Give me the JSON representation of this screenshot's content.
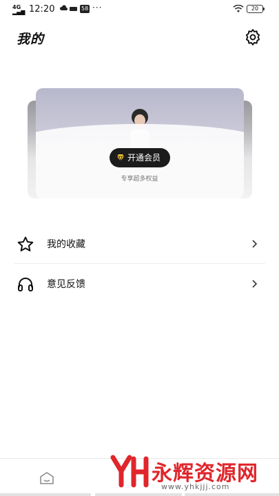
{
  "status_bar": {
    "signal_text": "4G",
    "time": "12:20",
    "badge": "58",
    "more_dots": "···",
    "battery": "20"
  },
  "header": {
    "title": "我的"
  },
  "member_card": {
    "button_label": "开通会员",
    "subtitle": "专享超多权益"
  },
  "menu": {
    "items": [
      {
        "label": "我的收藏",
        "icon": "star-icon"
      },
      {
        "label": "意见反馈",
        "icon": "headphones-icon"
      }
    ]
  },
  "watermark": {
    "title": "永辉资源网",
    "url": "www.yhkjjj.com"
  },
  "colors": {
    "accent_gold": "#f5c43a",
    "watermark_red": "#e0262b",
    "dark_button": "#1c1c1c"
  }
}
